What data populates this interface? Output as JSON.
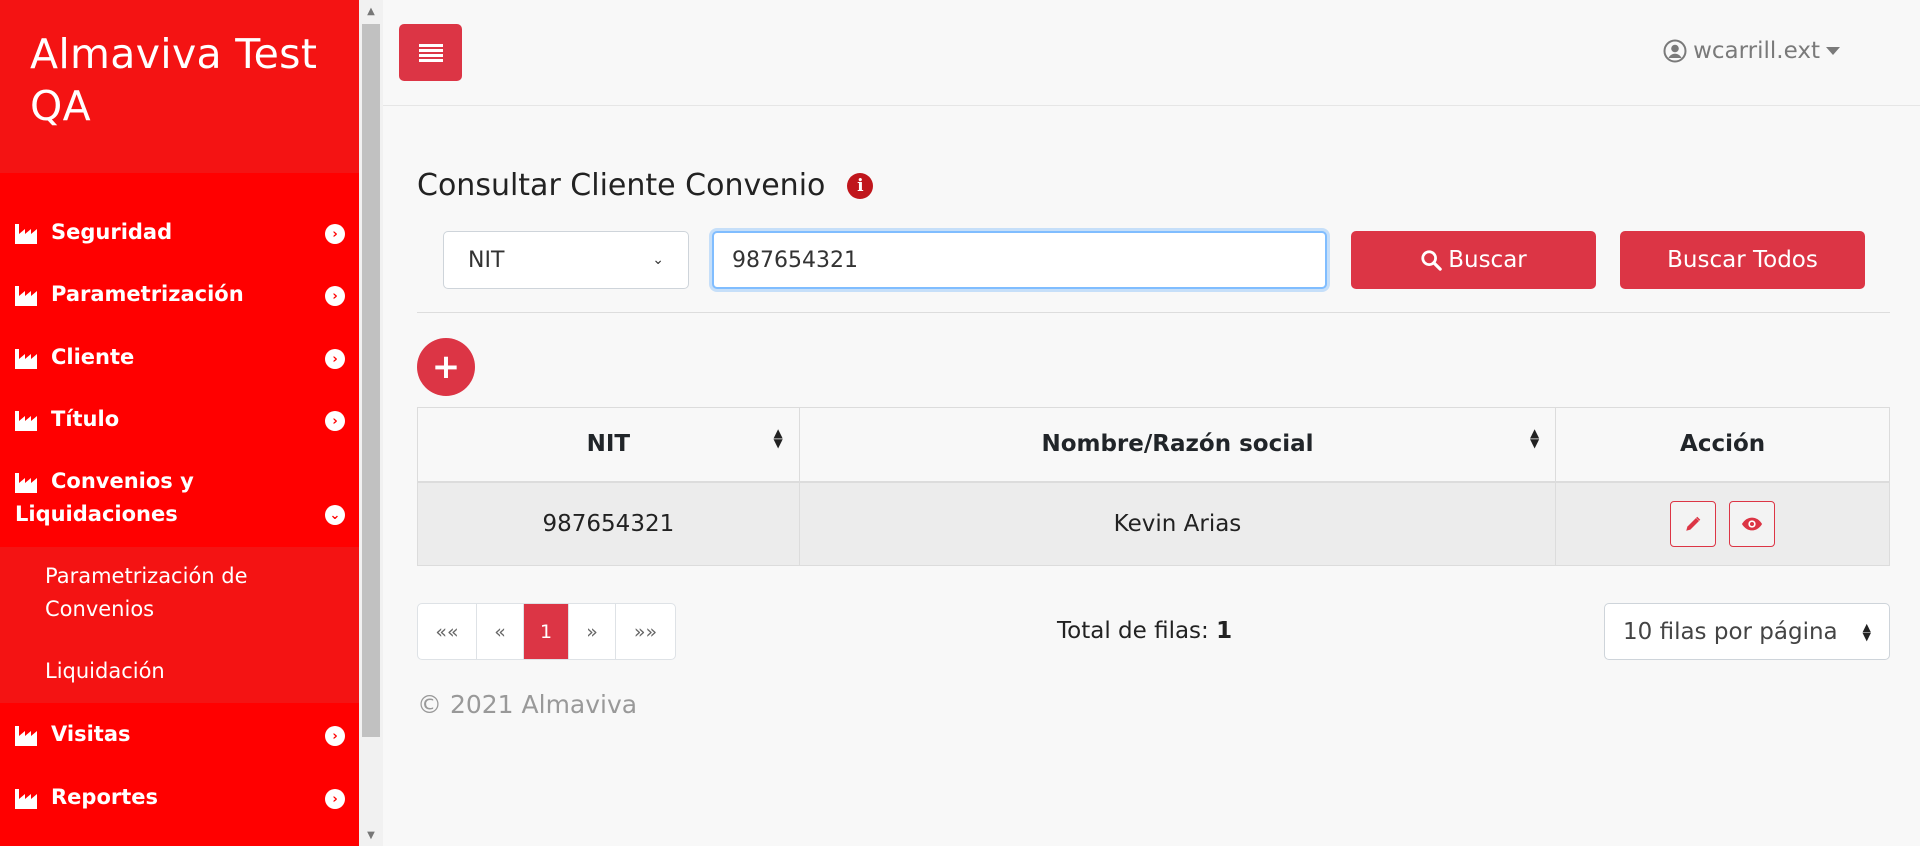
{
  "sidebar": {
    "brand": "Almaviva Test QA",
    "items": [
      {
        "label": "Seguridad",
        "icon": "factory-icon"
      },
      {
        "label": "Parametrización",
        "icon": "factory-icon"
      },
      {
        "label": "Cliente",
        "icon": "factory-icon"
      },
      {
        "label": "Título",
        "icon": "factory-icon"
      },
      {
        "label": "Convenios y Liquidaciones",
        "icon": "factory-icon",
        "expanded": true
      },
      {
        "label": "Visitas",
        "icon": "factory-icon"
      },
      {
        "label": "Reportes",
        "icon": "factory-icon"
      }
    ],
    "submenu": [
      "Parametrización de Convenios",
      "Liquidación"
    ]
  },
  "header": {
    "user": "wcarrill.ext"
  },
  "page": {
    "title": "Consultar Cliente Convenio"
  },
  "search": {
    "type_selected": "NIT",
    "value": "987654321",
    "buscar_label": "Buscar",
    "buscar_todos_label": "Buscar Todos"
  },
  "table": {
    "columns": [
      "NIT",
      "Nombre/Razón social",
      "Acción"
    ],
    "rows": [
      {
        "nit": "987654321",
        "nombre": "Kevin Arias"
      }
    ]
  },
  "pagination": {
    "first": "««",
    "prev": "«",
    "current": "1",
    "next": "»",
    "last": "»»",
    "total_label": "Total de filas:",
    "total_value": "1",
    "per_page": "10 filas por página"
  },
  "footer": "© 2021 Almaviva",
  "colors": {
    "sidebar": "#ff0000",
    "brand_bg": "#f41313",
    "accent": "#dc3545"
  }
}
